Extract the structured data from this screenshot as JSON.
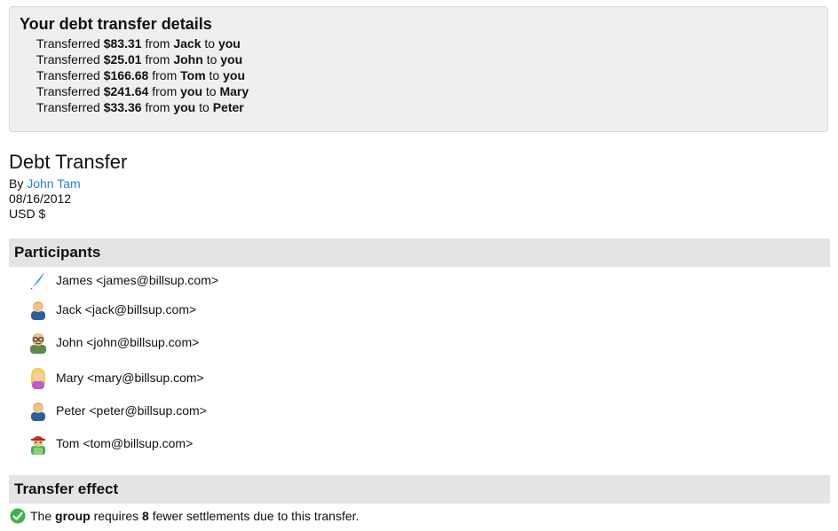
{
  "summary": {
    "heading": "Your debt transfer details",
    "transfers": [
      {
        "prefix": "Transferred",
        "amount": "$83.31",
        "from_word": "from",
        "from": "Jack",
        "to_word": "to",
        "to": "you"
      },
      {
        "prefix": "Transferred",
        "amount": "$25.01",
        "from_word": "from",
        "from": "John",
        "to_word": "to",
        "to": "you"
      },
      {
        "prefix": "Transferred",
        "amount": "$166.68",
        "from_word": "from",
        "from": "Tom",
        "to_word": "to",
        "to": "you"
      },
      {
        "prefix": "Transferred",
        "amount": "$241.64",
        "from_word": "from",
        "from": "you",
        "to_word": "to",
        "to": "Mary"
      },
      {
        "prefix": "Transferred",
        "amount": "$33.36",
        "from_word": "from",
        "from": "you",
        "to_word": "to",
        "to": "Peter"
      }
    ]
  },
  "bill": {
    "title": "Debt Transfer",
    "by_label": "By",
    "author": "John Tam",
    "date": "08/16/2012",
    "currency": "USD $"
  },
  "participants": {
    "heading": "Participants",
    "items": [
      {
        "label": "James <james@billsup.com>",
        "icon": "feather-icon"
      },
      {
        "label": "Jack <jack@billsup.com>",
        "icon": "male-user-icon"
      },
      {
        "label": "John <john@billsup.com>",
        "icon": "glasses-user-icon"
      },
      {
        "label": "Mary <mary@billsup.com>",
        "icon": "female-user-icon"
      },
      {
        "label": "Peter <peter@billsup.com>",
        "icon": "male-user-icon"
      },
      {
        "label": "Tom <tom@billsup.com>",
        "icon": "cap-user-icon"
      }
    ]
  },
  "effect": {
    "heading": "Transfer effect",
    "text_prefix": "The",
    "group_word": "group",
    "text_mid": "requires",
    "count": "8",
    "text_suffix": "fewer settlements due to this transfer.",
    "icon": "check-icon",
    "accent": "#3cb44b"
  },
  "colors": {
    "link": "#2a7fd4",
    "summary_bg": "#efefef",
    "header_bg": "#e4e4e4"
  }
}
